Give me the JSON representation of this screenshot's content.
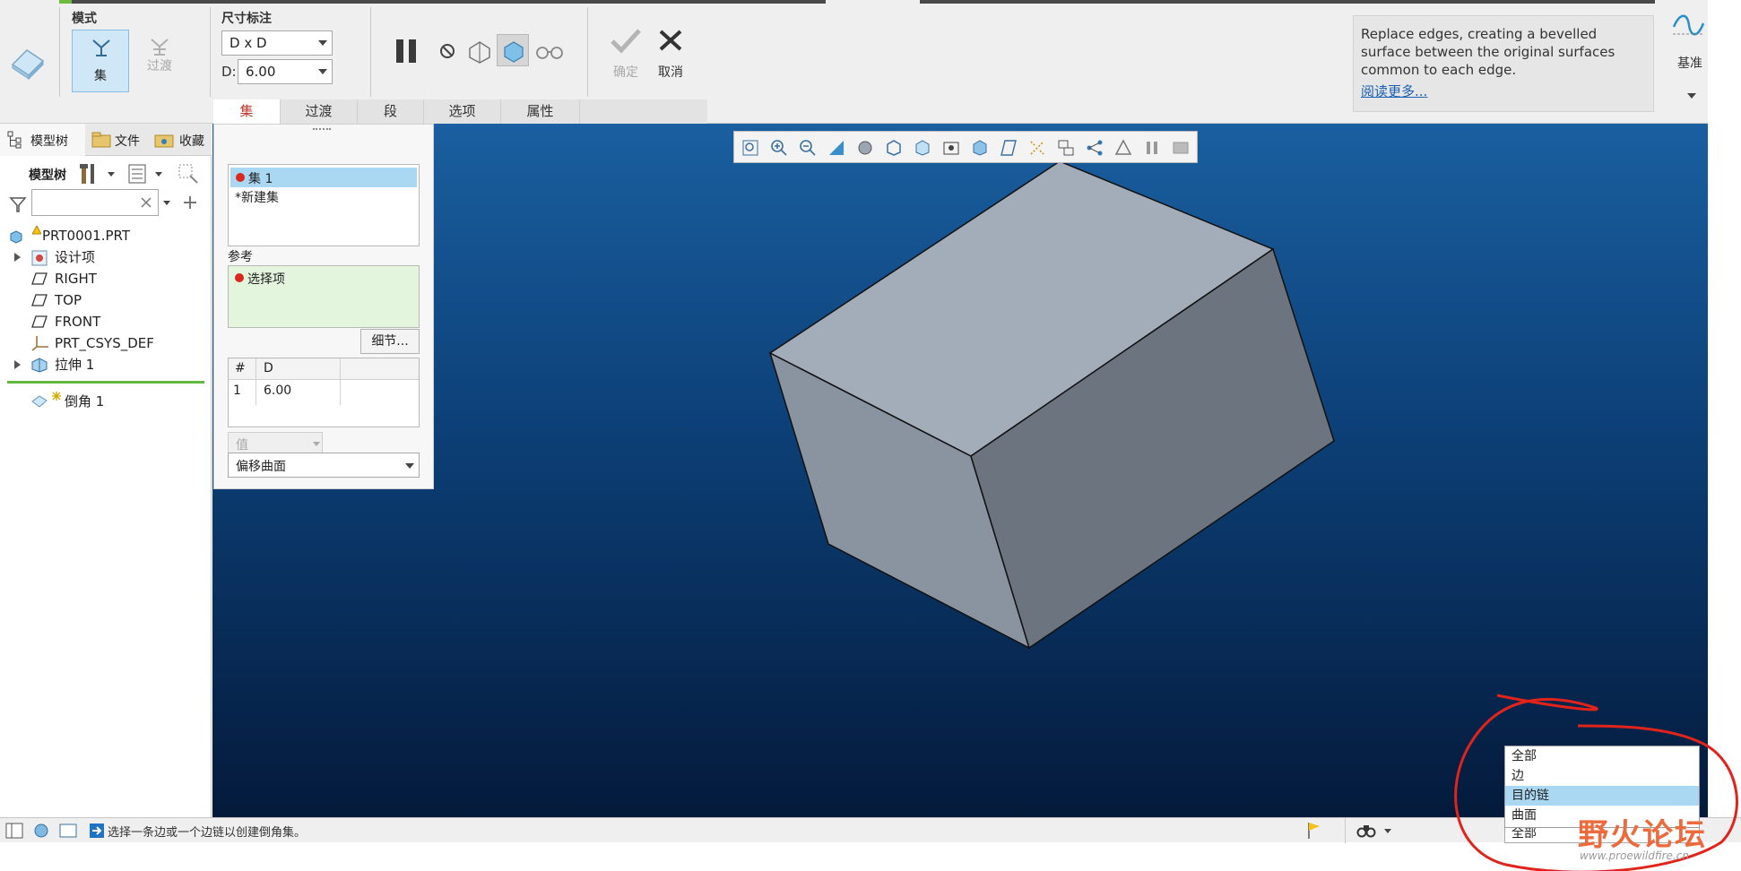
{
  "ribbon": {
    "mode_label": "模式",
    "mode_set": "集",
    "mode_transition": "过渡",
    "dim_label": "尺寸标注",
    "dim_scheme": "D x D",
    "d_label": "D:",
    "d_value": "6.00",
    "ok_label": "确定",
    "cancel_label": "取消",
    "datum_label": "基准",
    "tabs": [
      "集",
      "过渡",
      "段",
      "选项",
      "属性"
    ],
    "help_text": "Replace edges, creating a bevelled surface between the original surfaces common to each edge.",
    "help_link": "阅读更多..."
  },
  "left": {
    "tabs": [
      "模型树",
      "文件",
      "收藏"
    ],
    "toolbar_label": "模型树",
    "search_placeholder": "",
    "tree": [
      {
        "label": "PRT0001.PRT",
        "icon": "part-icon"
      },
      {
        "label": "设计项",
        "icon": "design-items-icon"
      },
      {
        "label": "RIGHT",
        "icon": "datum-plane-icon"
      },
      {
        "label": "TOP",
        "icon": "datum-plane-icon"
      },
      {
        "label": "FRONT",
        "icon": "datum-plane-icon"
      },
      {
        "label": "PRT_CSYS_DEF",
        "icon": "csys-icon"
      },
      {
        "label": "拉伸 1",
        "icon": "extrude-icon"
      },
      {
        "label": "倒角 1",
        "icon": "chamfer-icon"
      }
    ]
  },
  "sets": {
    "items": [
      "集 1",
      "*新建集"
    ],
    "ref_label": "参考",
    "ref_item": "选择项",
    "details_button": "细节...",
    "table_headers": [
      "#",
      "D"
    ],
    "table_rows": [
      [
        "1",
        "6.00"
      ]
    ],
    "value_label": "值",
    "offset_surface": "偏移曲面"
  },
  "status": {
    "message": "选择一条边或一个边链以创建倒角集。",
    "filter_value": "全部"
  },
  "popup": {
    "items": [
      "全部",
      "边",
      "目的链",
      "曲面"
    ],
    "selected": "目的链"
  },
  "watermark": {
    "text": "野火论坛",
    "url": "www.proewildfire.cn"
  },
  "colors": {
    "accent": "#c0392b",
    "selection": "#aad8f2",
    "bg_top": "#1a5fa0",
    "bg_bottom": "#041a3b",
    "box_top": "#a3adba",
    "box_left": "#8a94a1",
    "box_right": "#6c7480"
  }
}
